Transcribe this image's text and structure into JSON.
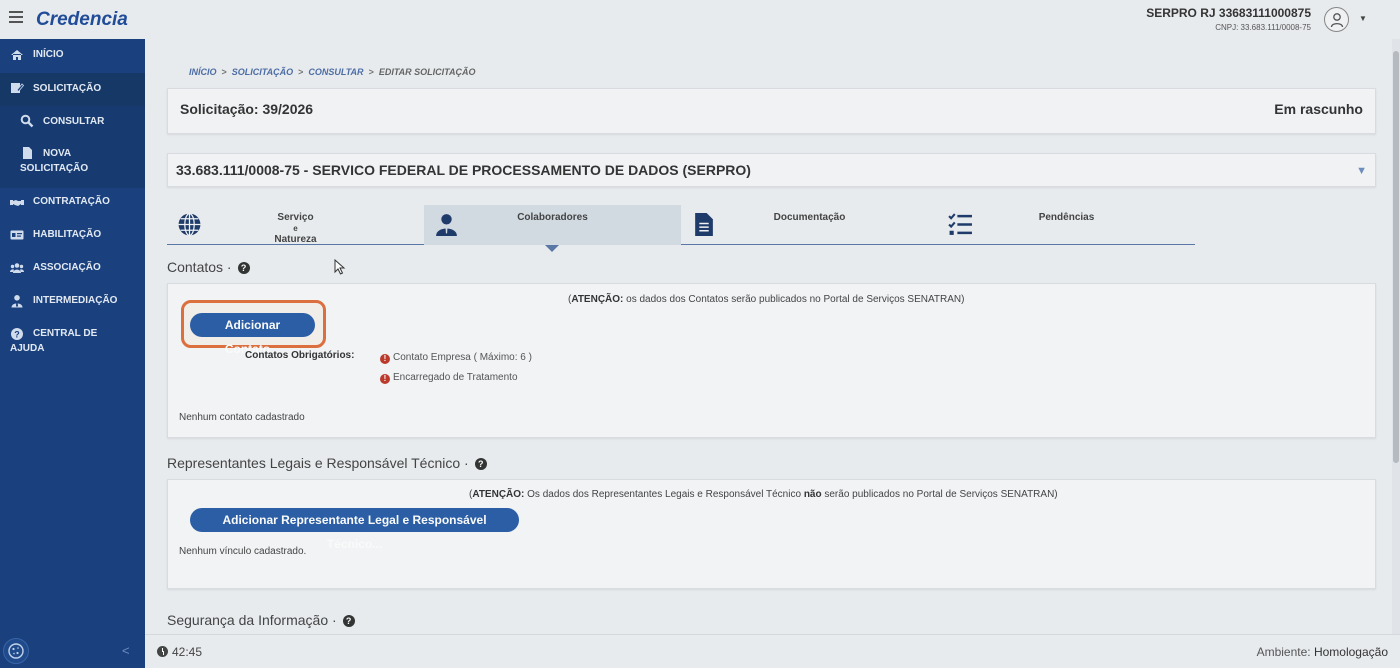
{
  "header": {
    "brand": "Credencia",
    "user_name": "SERPRO RJ 33683111000875",
    "user_cnpj": "CNPJ: 33.683.111/0008-75"
  },
  "sidebar": {
    "items": [
      {
        "label": "INÍCIO",
        "icon": "home-icon"
      },
      {
        "label": "SOLICITAÇÃO",
        "icon": "edit-icon"
      },
      {
        "label": "CONSULTAR",
        "icon": "search-icon"
      },
      {
        "label": "NOVA SOLICITAÇÃO",
        "icon": "file-icon"
      },
      {
        "label": "CONTRATAÇÃO",
        "icon": "handshake-icon"
      },
      {
        "label": "HABILITAÇÃO",
        "icon": "id-card-icon"
      },
      {
        "label": "ASSOCIAÇÃO",
        "icon": "users-icon"
      },
      {
        "label": "INTERMEDIAÇÃO",
        "icon": "user-tie-icon"
      },
      {
        "label": "CENTRAL DE AJUDA",
        "icon": "help-icon"
      }
    ]
  },
  "breadcrumb": {
    "items": [
      "INÍCIO",
      "SOLICITAÇÃO",
      "CONSULTAR"
    ],
    "current": "EDITAR SOLICITAÇÃO",
    "separator": ">"
  },
  "solicitacao": {
    "title": "Solicitação: 39/2026",
    "status": "Em rascunho"
  },
  "organization": {
    "name": "33.683.111/0008-75 - SERVICO FEDERAL DE PROCESSAMENTO DE DADOS (SERPRO)"
  },
  "tabs": [
    {
      "label_line1": "Serviço",
      "label_line2": "e",
      "label_line3": "Natureza",
      "icon": "globe-icon"
    },
    {
      "label_line1": "Colaboradores",
      "icon": "user-icon"
    },
    {
      "label_line1": "Documentação",
      "icon": "document-icon"
    },
    {
      "label_line1": "Pendências",
      "icon": "checklist-icon"
    }
  ],
  "contatos": {
    "title": "Contatos ·",
    "notice_bold": "ATENÇÃO:",
    "notice_text": "os dados dos Contatos serão publicados no Portal de Serviços SENATRAN)",
    "notice_open": "(",
    "add_button": "Adicionar Contato...",
    "required_label": "Contatos Obrigatórios:",
    "required_items": [
      "Contato Empresa ( Máximo: 6 )",
      "Encarregado de Tratamento"
    ],
    "empty": "Nenhum contato cadastrado"
  },
  "representantes": {
    "title": "Representantes Legais e Responsável Técnico ·",
    "notice_open": "(",
    "notice_bold": "ATENÇÃO:",
    "notice_text_a": "Os dados dos Representantes Legais e Responsável Técnico",
    "notice_bold2": "não",
    "notice_text_b": "serão publicados no Portal de Serviços SENATRAN)",
    "add_button": "Adicionar Representante Legal e Responsável Técnico...",
    "empty": "Nenhum vínculo cadastrado."
  },
  "seguranca": {
    "title": "Segurança da Informação ·"
  },
  "footer": {
    "timer": "42:45",
    "env_label": "Ambiente:",
    "env_value": "Homologação"
  },
  "colors": {
    "sidebar": "#19417f",
    "accent": "#2c5ea8",
    "highlight": "#e0703d",
    "error": "#c0392b"
  }
}
